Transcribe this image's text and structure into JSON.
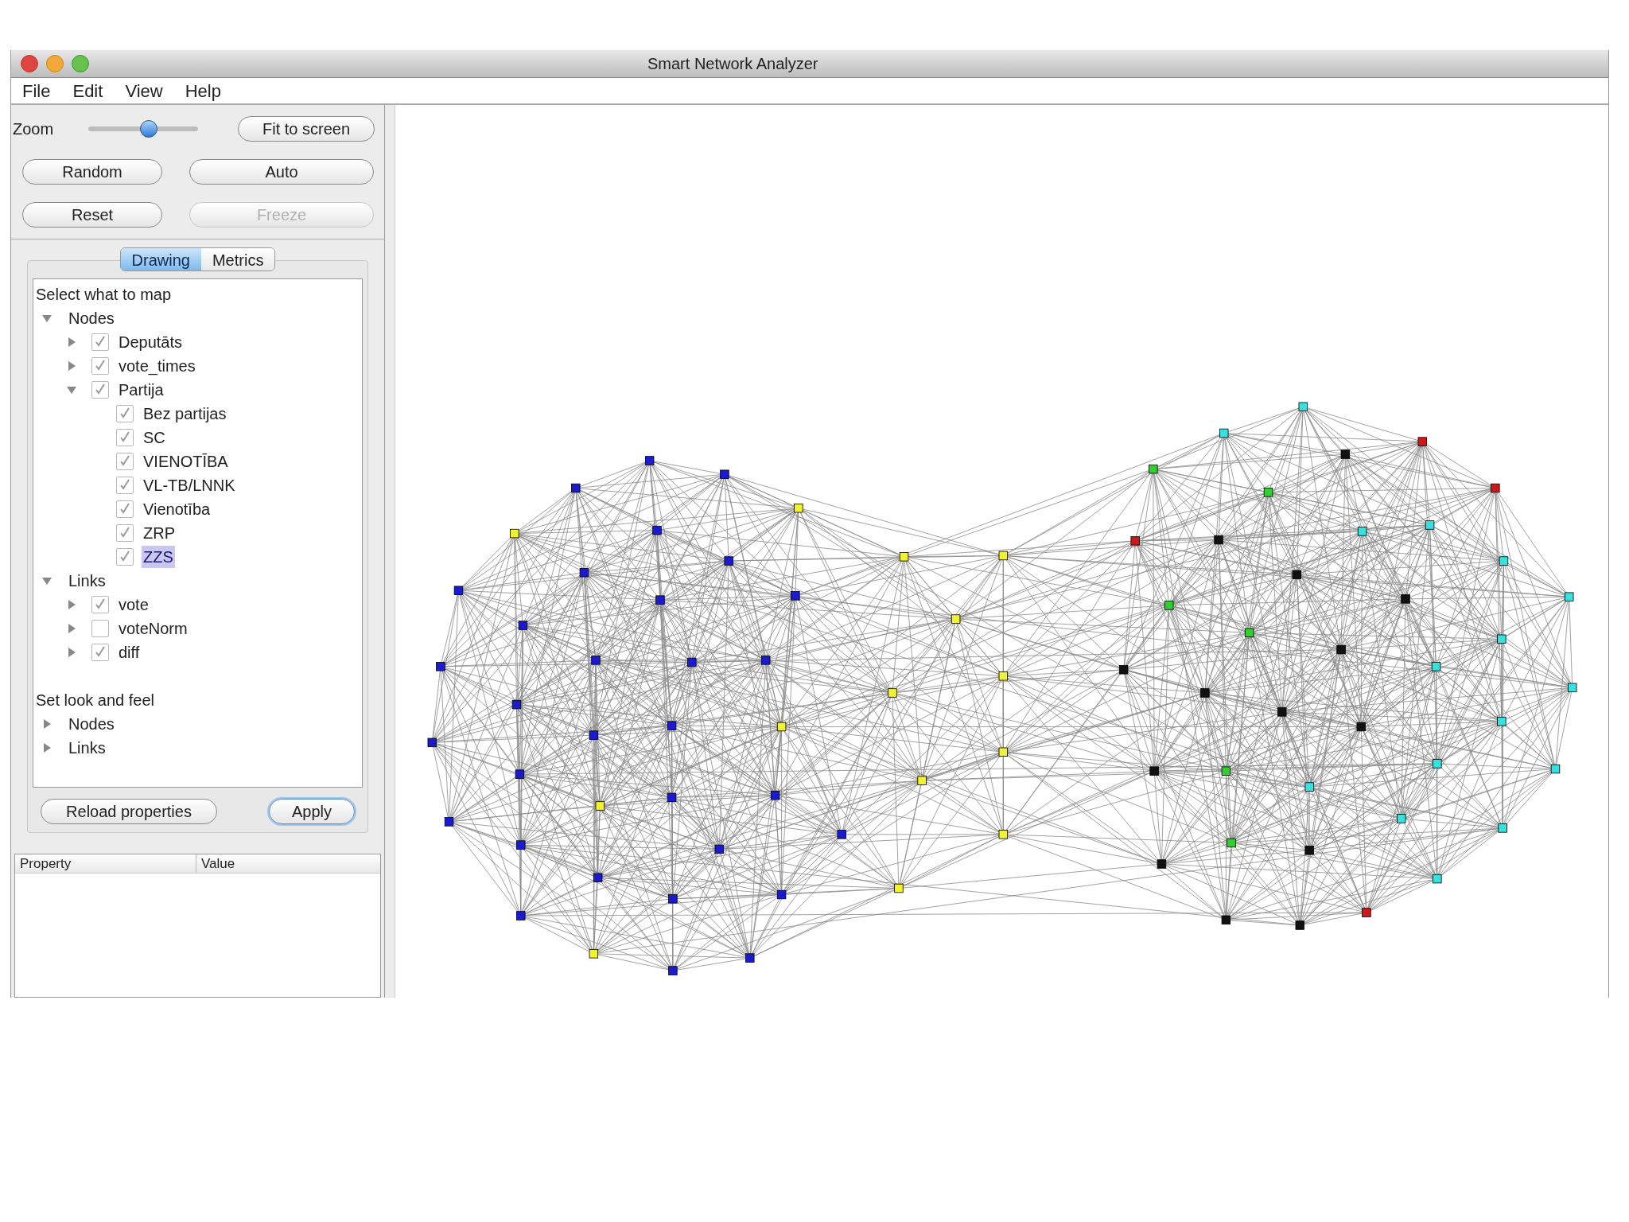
{
  "window": {
    "title": "Smart Network Analyzer"
  },
  "menu": [
    "File",
    "Edit",
    "View",
    "Help"
  ],
  "zoom": {
    "label": "Zoom",
    "level": 0.55
  },
  "fit_button": {
    "label": "Fit to screen",
    "disabled": false
  },
  "layout_buttons": [
    {
      "label": "Random",
      "disabled": false
    },
    {
      "label": "Auto",
      "disabled": false
    },
    {
      "label": "Reset",
      "disabled": false
    },
    {
      "label": "Freeze",
      "disabled": true
    }
  ],
  "tabs": [
    {
      "label": "Drawing",
      "selected": true
    },
    {
      "label": "Metrics",
      "selected": false
    }
  ],
  "tree_sections": [
    {
      "heading": "Select what to map",
      "items": [
        {
          "label": "Nodes",
          "expanded": true,
          "selected": false,
          "children": [
            {
              "label": "Deputāts",
              "checked": true,
              "expanded": false,
              "selected": false
            },
            {
              "label": "vote_times",
              "checked": true,
              "expanded": false,
              "selected": false
            },
            {
              "label": "Partija",
              "checked": true,
              "expanded": true,
              "selected": false,
              "children": [
                {
                  "label": "Bez partijas",
                  "checked": true,
                  "selected": false
                },
                {
                  "label": "SC",
                  "checked": true,
                  "selected": false
                },
                {
                  "label": "VIENOTĪBA",
                  "checked": true,
                  "selected": false
                },
                {
                  "label": "VL-TB/LNNK",
                  "checked": true,
                  "selected": false
                },
                {
                  "label": "Vienotība",
                  "checked": true,
                  "selected": false
                },
                {
                  "label": "ZRP",
                  "checked": true,
                  "selected": false
                },
                {
                  "label": "ZZS",
                  "checked": true,
                  "selected": true
                }
              ]
            }
          ]
        },
        {
          "label": "Links",
          "expanded": true,
          "selected": false,
          "children": [
            {
              "label": "vote",
              "checked": true,
              "expanded": false,
              "selected": false
            },
            {
              "label": "voteNorm",
              "checked": false,
              "expanded": false,
              "selected": false
            },
            {
              "label": "diff",
              "checked": true,
              "expanded": false,
              "selected": false
            }
          ]
        }
      ]
    },
    {
      "heading": "Set look and feel",
      "items": [
        {
          "label": "Nodes",
          "expanded": false,
          "selected": false
        },
        {
          "label": "Links",
          "expanded": false,
          "selected": false
        }
      ]
    }
  ],
  "panel_buttons": [
    {
      "label": "Reload properties",
      "default": false
    },
    {
      "label": "Apply",
      "default": true
    }
  ],
  "property_table": {
    "columns": [
      "Property",
      "Value"
    ]
  }
}
